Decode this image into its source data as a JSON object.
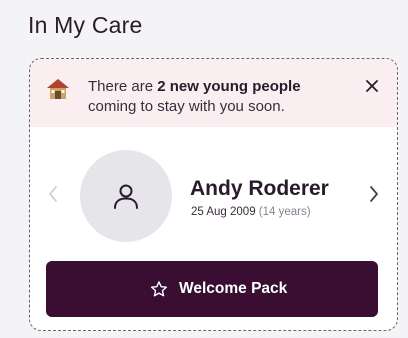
{
  "page": {
    "title": "In My Care"
  },
  "banner": {
    "text_prefix": "There are ",
    "text_bold": "2 new young people",
    "text_suffix": " coming to stay with you soon.",
    "icon": "house-icon",
    "close_icon": "close-icon"
  },
  "person": {
    "name": "Andy Roderer",
    "dob": "25 Aug 2009",
    "age": "(14 years)",
    "avatar_icon": "user-icon"
  },
  "carousel": {
    "prev_icon": "chevron-left-icon",
    "next_icon": "chevron-right-icon"
  },
  "actions": {
    "welcome_pack_label": "Welcome Pack",
    "welcome_pack_icon": "star-icon"
  },
  "colors": {
    "primary": "#3a0e32",
    "banner_bg": "#fbeef0",
    "page_bg": "#f4f4f7",
    "avatar_bg": "#e6e5ea"
  }
}
